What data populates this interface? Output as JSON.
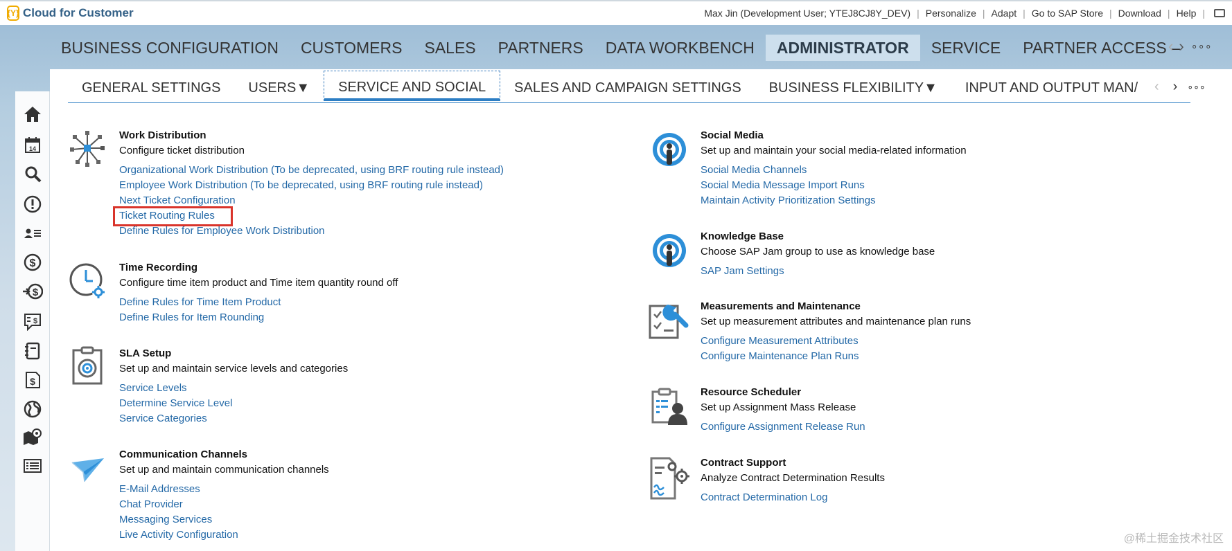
{
  "app": {
    "logo_mark": "{Y}",
    "title": "Cloud for Customer"
  },
  "shell_links": {
    "user": "Max Jin (Development User; YTEJ8CJ8Y_DEV)",
    "personalize": "Personalize",
    "adapt": "Adapt",
    "store": "Go to SAP Store",
    "download": "Download",
    "help": "Help",
    "separator": "|"
  },
  "main_nav": {
    "items": [
      {
        "label": "BUSINESS CONFIGURATION"
      },
      {
        "label": "CUSTOMERS"
      },
      {
        "label": "SALES"
      },
      {
        "label": "PARTNERS"
      },
      {
        "label": "DATA WORKBENCH"
      },
      {
        "label": "ADMINISTRATOR"
      },
      {
        "label": "SERVICE"
      },
      {
        "label": "PARTNER ACCESS –"
      }
    ],
    "active": "ADMINISTRATOR",
    "prev": "‹",
    "next": "›",
    "more": "∘∘∘"
  },
  "sub_nav": {
    "tabs": [
      {
        "label": "GENERAL SETTINGS"
      },
      {
        "label": "USERS▼"
      },
      {
        "label": "SERVICE AND SOCIAL"
      },
      {
        "label": "SALES AND CAMPAIGN SETTINGS"
      },
      {
        "label": "BUSINESS FLEXIBILITY▼"
      },
      {
        "label": "INPUT AND OUTPUT MAN/"
      }
    ],
    "active": "SERVICE AND SOCIAL",
    "prev": "‹",
    "next": "›",
    "more": "∘∘∘"
  },
  "sidebar": {
    "icons": [
      "home-icon",
      "calendar-icon",
      "search-icon",
      "alert-icon",
      "contacts-icon",
      "dollar-icon",
      "dollar-transfer-icon",
      "quote-icon",
      "notebook-icon",
      "invoice-icon",
      "globe-icon",
      "map-icon",
      "list-icon"
    ]
  },
  "left_sections": [
    {
      "title": "Work Distribution",
      "desc": "Configure ticket distribution",
      "icon": "work-distribution-icon",
      "links": [
        "Organizational Work Distribution (To be deprecated, using BRF routing rule instead)",
        "Employee Work Distribution (To be deprecated, using BRF routing rule instead)",
        "Next Ticket Configuration",
        "Ticket Routing Rules",
        "Define Rules for Employee Work Distribution"
      ]
    },
    {
      "title": "Time Recording",
      "desc": "Configure time item product and Time item quantity round off",
      "icon": "time-recording-icon",
      "links": [
        "Define Rules for Time Item Product",
        "Define Rules for Item Rounding"
      ]
    },
    {
      "title": "SLA Setup",
      "desc": "Set up and maintain service levels and categories",
      "icon": "sla-setup-icon",
      "links": [
        "Service Levels",
        "Determine Service Level",
        "Service Categories"
      ]
    },
    {
      "title": "Communication Channels",
      "desc": "Set up and maintain communication channels",
      "icon": "paper-plane-icon",
      "links": [
        "E-Mail Addresses",
        "Chat Provider",
        "Messaging Services",
        "Live Activity Configuration"
      ]
    }
  ],
  "right_sections": [
    {
      "title": "Social Media",
      "desc": "Set up and maintain your social media-related information",
      "icon": "social-media-icon",
      "links": [
        "Social Media Channels",
        "Social Media Message Import Runs",
        "Maintain Activity Prioritization Settings"
      ]
    },
    {
      "title": "Knowledge Base",
      "desc": "Choose SAP Jam group to use as knowledge base",
      "icon": "knowledge-base-icon",
      "links": [
        "SAP Jam Settings"
      ]
    },
    {
      "title": "Measurements and Maintenance",
      "desc": "Set up measurement attributes and maintenance plan runs",
      "icon": "measurement-wrench-icon",
      "links": [
        "Configure Measurement Attributes",
        "Configure Maintenance Plan Runs"
      ]
    },
    {
      "title": "Resource Scheduler",
      "desc": "Set up Assignment Mass Release",
      "icon": "resource-scheduler-icon",
      "links": [
        "Configure Assignment Release Run"
      ]
    },
    {
      "title": "Contract Support",
      "desc": "Analyze Contract Determination Results",
      "icon": "contract-gear-icon",
      "links": [
        "Contract Determination Log"
      ]
    }
  ],
  "watermark": "@稀土掘金技术社区",
  "colors": {
    "link": "#2469a7",
    "accent": "#2d7ec4",
    "highlight": "#d9342b",
    "logo": "#f0ab00"
  }
}
